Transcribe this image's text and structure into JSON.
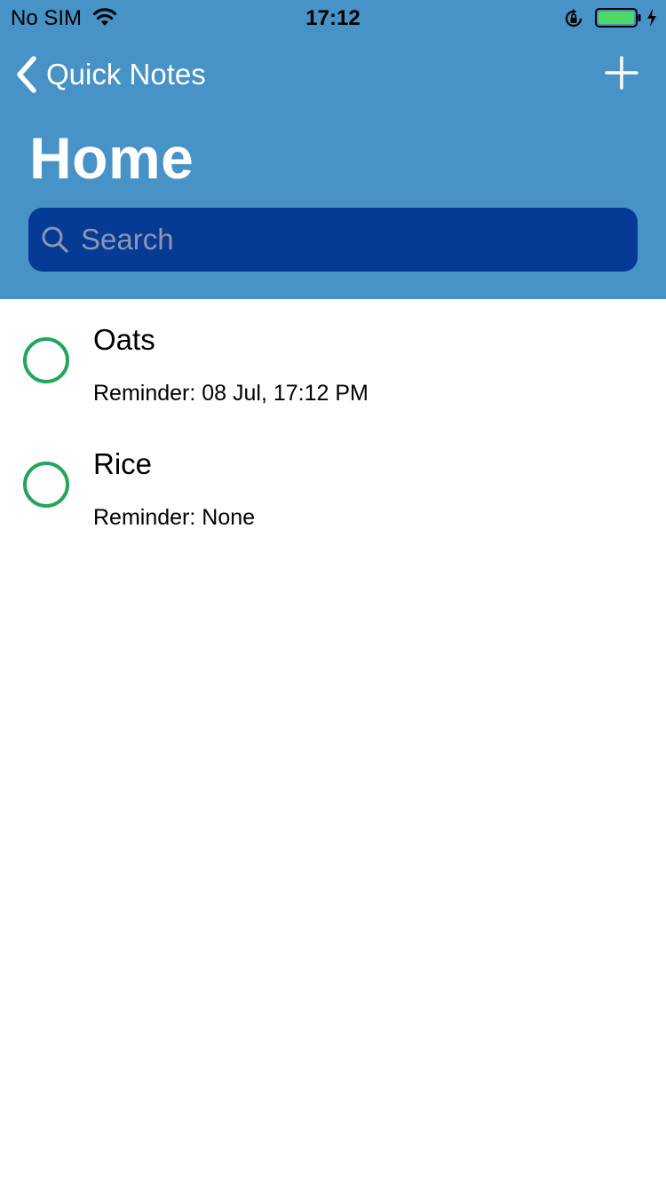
{
  "status_bar": {
    "carrier": "No SIM",
    "time": "17:12",
    "icons": [
      "wifi-icon",
      "orientation-lock-icon",
      "battery-icon",
      "charging-icon"
    ],
    "battery_color": "#4cd964"
  },
  "nav": {
    "back_label": "Quick Notes",
    "add_icon": "plus-icon"
  },
  "page": {
    "title": "Home"
  },
  "search": {
    "placeholder": "Search",
    "value": ""
  },
  "notes": [
    {
      "title": "Oats",
      "reminder": "Reminder: 08 Jul, 17:12 PM",
      "completed": false
    },
    {
      "title": "Rice",
      "reminder": "Reminder: None",
      "completed": false
    }
  ],
  "colors": {
    "header_bg": "#4792c6",
    "search_bg": "#053a95",
    "check_circle": "#24a55a"
  }
}
